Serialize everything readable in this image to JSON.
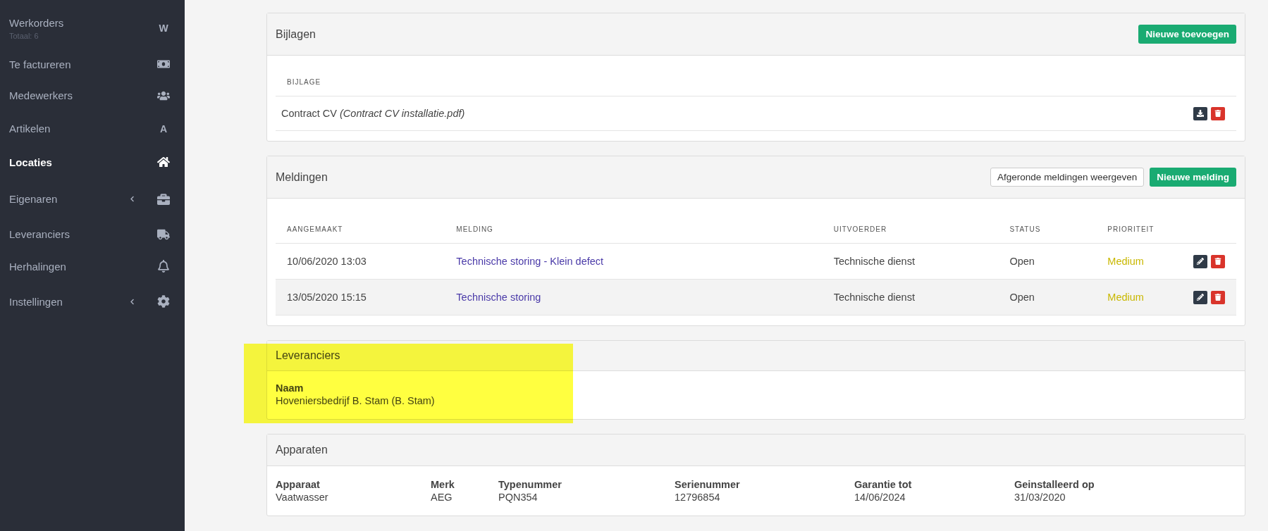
{
  "sidebar": {
    "items": [
      {
        "label": "Werkorders",
        "sublabel": "Totaal: 6",
        "icon_letter": "W",
        "selected": false,
        "has_submenu": false
      },
      {
        "label": "Te factureren",
        "selected": false,
        "has_submenu": false
      },
      {
        "label": "Medewerkers",
        "selected": false,
        "has_submenu": false
      },
      {
        "label": "Artikelen",
        "icon_letter": "A",
        "selected": false,
        "has_submenu": false
      },
      {
        "label": "Locaties",
        "selected": true,
        "has_submenu": false
      },
      {
        "label": "Eigenaren",
        "selected": false,
        "has_submenu": true
      },
      {
        "label": "Leveranciers",
        "selected": false,
        "has_submenu": false
      },
      {
        "label": "Herhalingen",
        "selected": false,
        "has_submenu": false
      },
      {
        "label": "Instellingen",
        "selected": false,
        "has_submenu": true
      }
    ]
  },
  "attachments": {
    "title": "Bijlagen",
    "add_button": "Nieuwe toevoegen",
    "column": "BIJLAGE",
    "rows": [
      {
        "name": "Contract CV",
        "file": "(Contract CV installatie.pdf)"
      }
    ]
  },
  "notifications": {
    "title": "Meldingen",
    "toggle_button": "Afgeronde meldingen weergeven",
    "add_button": "Nieuwe melding",
    "columns": [
      "AANGEMAAKT",
      "MELDING",
      "UITVOERDER",
      "STATUS",
      "PRIORITEIT"
    ],
    "rows": [
      {
        "created": "10/06/2020 13:03",
        "title": "Technische storing - Klein defect",
        "executor": "Technische dienst",
        "status": "Open",
        "priority": {
          "text": "Medium",
          "color": "#c9b800"
        }
      },
      {
        "created": "13/05/2020 15:15",
        "title": "Technische storing",
        "executor": "Technische dienst",
        "status": "Open",
        "priority": {
          "text": "Medium",
          "color": "#c9b800"
        }
      }
    ]
  },
  "suppliers": {
    "title": "Leveranciers",
    "highlighted": true,
    "label": "Naam",
    "value": "Hoveniersbedrijf B. Stam (B. Stam)"
  },
  "devices": {
    "title": "Apparaten",
    "fields": [
      {
        "label": "Apparaat",
        "value": "Vaatwasser"
      },
      {
        "label": "Merk",
        "value": "AEG"
      },
      {
        "label": "Typenummer",
        "value": "PQN354"
      },
      {
        "label": "Serienummer",
        "value": "12796854"
      },
      {
        "label": "Garantie tot",
        "value": "14/06/2024"
      },
      {
        "label": "Geinstalleerd op",
        "value": "31/03/2020"
      }
    ]
  }
}
